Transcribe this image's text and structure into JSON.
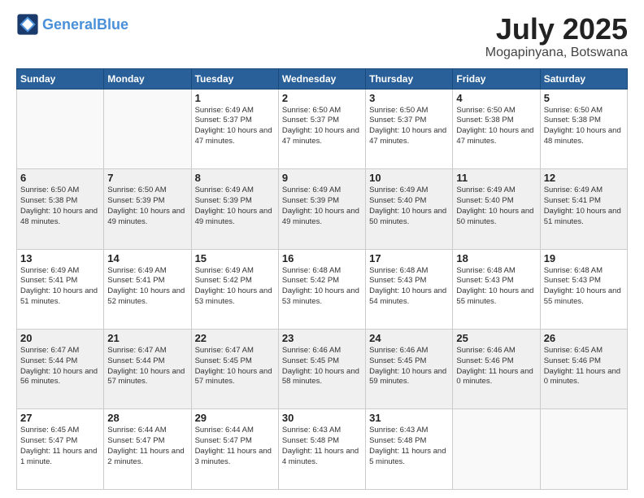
{
  "header": {
    "logo_general": "General",
    "logo_blue": "Blue",
    "month": "July 2025",
    "location": "Mogapinyana, Botswana"
  },
  "weekdays": [
    "Sunday",
    "Monday",
    "Tuesday",
    "Wednesday",
    "Thursday",
    "Friday",
    "Saturday"
  ],
  "weeks": [
    [
      {
        "day": "",
        "text": ""
      },
      {
        "day": "",
        "text": ""
      },
      {
        "day": "1",
        "text": "Sunrise: 6:49 AM\nSunset: 5:37 PM\nDaylight: 10 hours and 47 minutes."
      },
      {
        "day": "2",
        "text": "Sunrise: 6:50 AM\nSunset: 5:37 PM\nDaylight: 10 hours and 47 minutes."
      },
      {
        "day": "3",
        "text": "Sunrise: 6:50 AM\nSunset: 5:37 PM\nDaylight: 10 hours and 47 minutes."
      },
      {
        "day": "4",
        "text": "Sunrise: 6:50 AM\nSunset: 5:38 PM\nDaylight: 10 hours and 47 minutes."
      },
      {
        "day": "5",
        "text": "Sunrise: 6:50 AM\nSunset: 5:38 PM\nDaylight: 10 hours and 48 minutes."
      }
    ],
    [
      {
        "day": "6",
        "text": "Sunrise: 6:50 AM\nSunset: 5:38 PM\nDaylight: 10 hours and 48 minutes."
      },
      {
        "day": "7",
        "text": "Sunrise: 6:50 AM\nSunset: 5:39 PM\nDaylight: 10 hours and 49 minutes."
      },
      {
        "day": "8",
        "text": "Sunrise: 6:49 AM\nSunset: 5:39 PM\nDaylight: 10 hours and 49 minutes."
      },
      {
        "day": "9",
        "text": "Sunrise: 6:49 AM\nSunset: 5:39 PM\nDaylight: 10 hours and 49 minutes."
      },
      {
        "day": "10",
        "text": "Sunrise: 6:49 AM\nSunset: 5:40 PM\nDaylight: 10 hours and 50 minutes."
      },
      {
        "day": "11",
        "text": "Sunrise: 6:49 AM\nSunset: 5:40 PM\nDaylight: 10 hours and 50 minutes."
      },
      {
        "day": "12",
        "text": "Sunrise: 6:49 AM\nSunset: 5:41 PM\nDaylight: 10 hours and 51 minutes."
      }
    ],
    [
      {
        "day": "13",
        "text": "Sunrise: 6:49 AM\nSunset: 5:41 PM\nDaylight: 10 hours and 51 minutes."
      },
      {
        "day": "14",
        "text": "Sunrise: 6:49 AM\nSunset: 5:41 PM\nDaylight: 10 hours and 52 minutes."
      },
      {
        "day": "15",
        "text": "Sunrise: 6:49 AM\nSunset: 5:42 PM\nDaylight: 10 hours and 53 minutes."
      },
      {
        "day": "16",
        "text": "Sunrise: 6:48 AM\nSunset: 5:42 PM\nDaylight: 10 hours and 53 minutes."
      },
      {
        "day": "17",
        "text": "Sunrise: 6:48 AM\nSunset: 5:43 PM\nDaylight: 10 hours and 54 minutes."
      },
      {
        "day": "18",
        "text": "Sunrise: 6:48 AM\nSunset: 5:43 PM\nDaylight: 10 hours and 55 minutes."
      },
      {
        "day": "19",
        "text": "Sunrise: 6:48 AM\nSunset: 5:43 PM\nDaylight: 10 hours and 55 minutes."
      }
    ],
    [
      {
        "day": "20",
        "text": "Sunrise: 6:47 AM\nSunset: 5:44 PM\nDaylight: 10 hours and 56 minutes."
      },
      {
        "day": "21",
        "text": "Sunrise: 6:47 AM\nSunset: 5:44 PM\nDaylight: 10 hours and 57 minutes."
      },
      {
        "day": "22",
        "text": "Sunrise: 6:47 AM\nSunset: 5:45 PM\nDaylight: 10 hours and 57 minutes."
      },
      {
        "day": "23",
        "text": "Sunrise: 6:46 AM\nSunset: 5:45 PM\nDaylight: 10 hours and 58 minutes."
      },
      {
        "day": "24",
        "text": "Sunrise: 6:46 AM\nSunset: 5:45 PM\nDaylight: 10 hours and 59 minutes."
      },
      {
        "day": "25",
        "text": "Sunrise: 6:46 AM\nSunset: 5:46 PM\nDaylight: 11 hours and 0 minutes."
      },
      {
        "day": "26",
        "text": "Sunrise: 6:45 AM\nSunset: 5:46 PM\nDaylight: 11 hours and 0 minutes."
      }
    ],
    [
      {
        "day": "27",
        "text": "Sunrise: 6:45 AM\nSunset: 5:47 PM\nDaylight: 11 hours and 1 minute."
      },
      {
        "day": "28",
        "text": "Sunrise: 6:44 AM\nSunset: 5:47 PM\nDaylight: 11 hours and 2 minutes."
      },
      {
        "day": "29",
        "text": "Sunrise: 6:44 AM\nSunset: 5:47 PM\nDaylight: 11 hours and 3 minutes."
      },
      {
        "day": "30",
        "text": "Sunrise: 6:43 AM\nSunset: 5:48 PM\nDaylight: 11 hours and 4 minutes."
      },
      {
        "day": "31",
        "text": "Sunrise: 6:43 AM\nSunset: 5:48 PM\nDaylight: 11 hours and 5 minutes."
      },
      {
        "day": "",
        "text": ""
      },
      {
        "day": "",
        "text": ""
      }
    ]
  ]
}
